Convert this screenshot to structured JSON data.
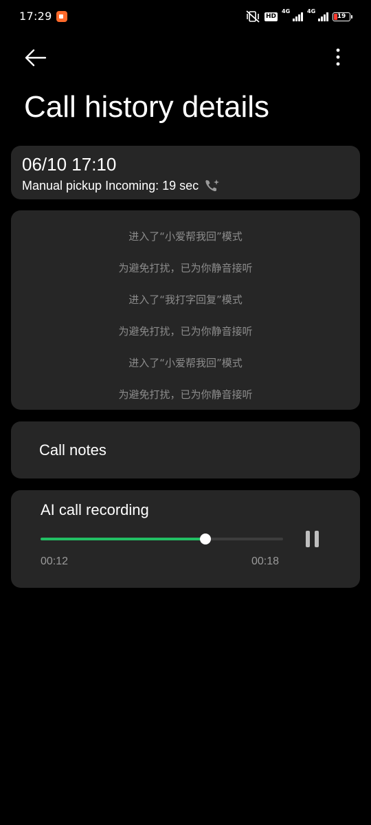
{
  "status_bar": {
    "time": "17:29",
    "hd_label": "HD",
    "network_1": "4G",
    "network_2": "4G",
    "battery_level": "19",
    "battery_color": "#ff3b30",
    "icons": [
      "screen-record-icon",
      "mute-vibrate-icon",
      "hd-icon",
      "signal-icon",
      "signal-icon",
      "battery-icon"
    ]
  },
  "header": {
    "back_icon": "arrow-left-icon",
    "more_icon": "vertical-dots-icon",
    "title": "Call history details"
  },
  "call": {
    "datetime": "06/10 17:10",
    "summary": "Manual pickup Incoming: 19 sec",
    "call_icon": "ai-incoming-call-icon"
  },
  "transcript": [
    "进入了“小爱帮我回”模式",
    "为避免打扰，已为你静音接听",
    "进入了“我打字回复”模式",
    "为避免打扰，已为你静音接听",
    "进入了“小爱帮我回”模式",
    "为避免打扰，已为你静音接听"
  ],
  "notes": {
    "label": "Call notes"
  },
  "recording": {
    "title": "AI call recording",
    "current_time": "00:12",
    "total_time": "00:18",
    "progress_fraction": 0.68,
    "accent_color": "#22c064",
    "control_icon": "pause-icon"
  }
}
